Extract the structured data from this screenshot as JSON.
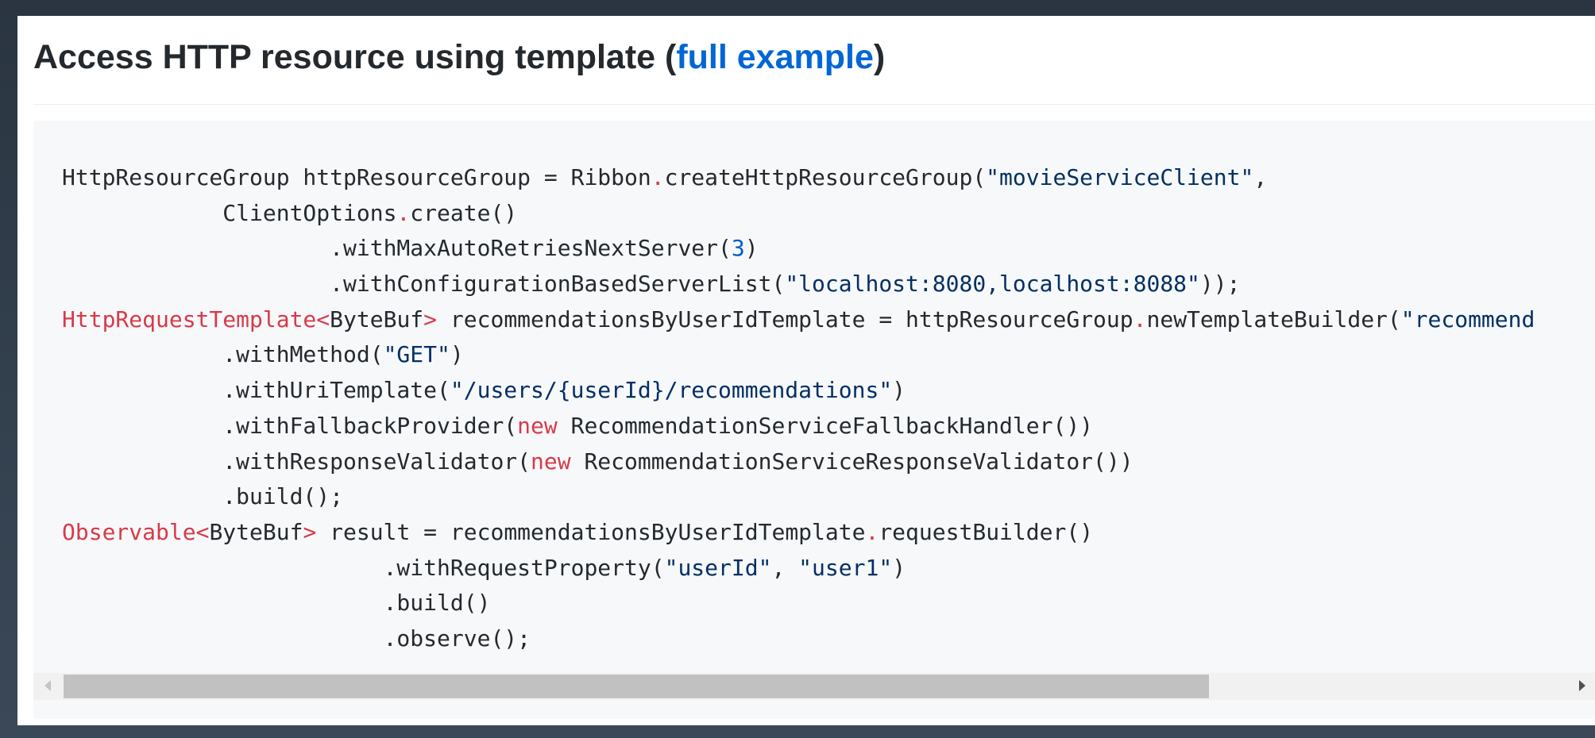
{
  "heading": {
    "title": "Access HTTP resource using template ",
    "paren_open": "(",
    "link_text": "full example",
    "paren_close": ")"
  },
  "code_lines": [
    [
      {
        "t": "HttpResourceGroup httpResourceGroup = Ribbon",
        "k": "plain"
      },
      {
        "t": ".",
        "k": "op"
      },
      {
        "t": "createHttpResourceGroup(",
        "k": "plain"
      },
      {
        "t": "\"movieServiceClient\"",
        "k": "str"
      },
      {
        "t": ",",
        "k": "plain"
      }
    ],
    [
      {
        "t": "            ClientOptions",
        "k": "plain"
      },
      {
        "t": ".",
        "k": "op"
      },
      {
        "t": "create()",
        "k": "plain"
      }
    ],
    [
      {
        "t": "                    .withMaxAutoRetriesNextServer(",
        "k": "plain"
      },
      {
        "t": "3",
        "k": "num"
      },
      {
        "t": ")",
        "k": "plain"
      }
    ],
    [
      {
        "t": "                    .withConfigurationBasedServerList(",
        "k": "plain"
      },
      {
        "t": "\"localhost:8080,localhost:8088\"",
        "k": "str"
      },
      {
        "t": "));",
        "k": "plain"
      }
    ],
    [
      {
        "t": "HttpRequestTemplate<",
        "k": "key"
      },
      {
        "t": "ByteBuf",
        "k": "plain"
      },
      {
        "t": ">",
        "k": "key"
      },
      {
        "t": " recommendationsByUserIdTemplate = httpResourceGroup",
        "k": "plain"
      },
      {
        "t": ".",
        "k": "op"
      },
      {
        "t": "newTemplateBuilder(",
        "k": "plain"
      },
      {
        "t": "\"recommend",
        "k": "str"
      }
    ],
    [
      {
        "t": "            .withMethod(",
        "k": "plain"
      },
      {
        "t": "\"GET\"",
        "k": "str"
      },
      {
        "t": ")",
        "k": "plain"
      }
    ],
    [
      {
        "t": "            .withUriTemplate(",
        "k": "plain"
      },
      {
        "t": "\"/users/{userId}/recommendations\"",
        "k": "str"
      },
      {
        "t": ")",
        "k": "plain"
      }
    ],
    [
      {
        "t": "            .withFallbackProvider(",
        "k": "plain"
      },
      {
        "t": "new",
        "k": "key"
      },
      {
        "t": " RecommendationServiceFallbackHandler())",
        "k": "plain"
      }
    ],
    [
      {
        "t": "            .withResponseValidator(",
        "k": "plain"
      },
      {
        "t": "new",
        "k": "key"
      },
      {
        "t": " RecommendationServiceResponseValidator())",
        "k": "plain"
      }
    ],
    [
      {
        "t": "            .build();",
        "k": "plain"
      }
    ],
    [
      {
        "t": "Observable<",
        "k": "key"
      },
      {
        "t": "ByteBuf",
        "k": "plain"
      },
      {
        "t": ">",
        "k": "key"
      },
      {
        "t": " result = recommendationsByUserIdTemplate",
        "k": "plain"
      },
      {
        "t": ".",
        "k": "op"
      },
      {
        "t": "requestBuilder()",
        "k": "plain"
      }
    ],
    [
      {
        "t": "                        .withRequestProperty(",
        "k": "plain"
      },
      {
        "t": "\"userId\"",
        "k": "str"
      },
      {
        "t": ", ",
        "k": "plain"
      },
      {
        "t": "\"user1\"",
        "k": "str"
      },
      {
        "t": ")",
        "k": "plain"
      }
    ],
    [
      {
        "t": "                        .build()",
        "k": "plain"
      }
    ],
    [
      {
        "t": "                        .observe();",
        "k": "plain"
      }
    ]
  ],
  "scroll": {
    "left_arrow": "scroll-left-arrow",
    "right_arrow": "scroll-right-arrow"
  },
  "colors": {
    "link": "#0366d6",
    "keyword": "#d73a49",
    "string": "#032f62",
    "number": "#005cc5",
    "code_bg": "#f6f8fa"
  }
}
